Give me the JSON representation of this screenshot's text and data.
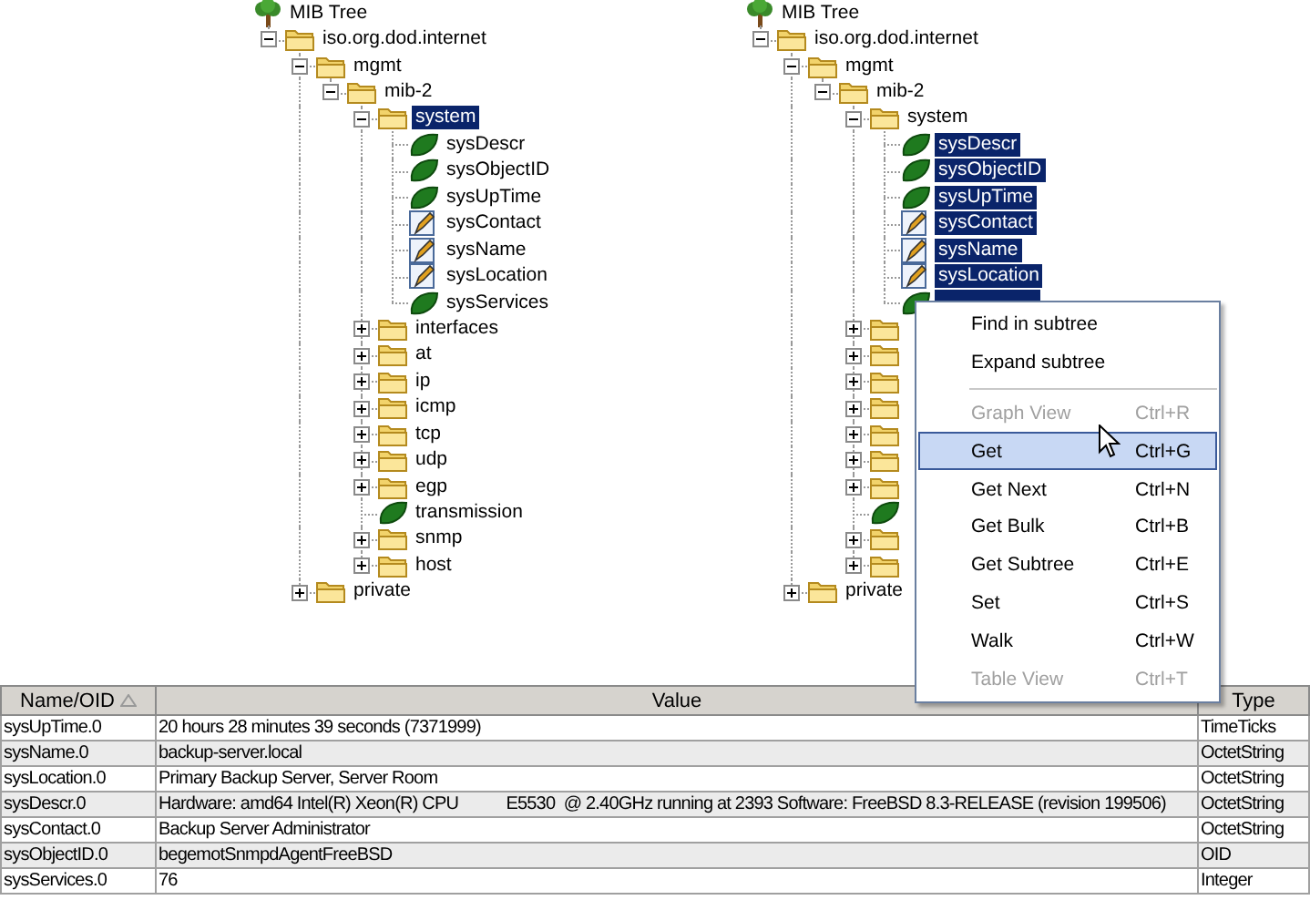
{
  "trees": [
    {
      "title": "MIB Tree",
      "nodes": [
        {
          "kind": "folder",
          "label": "iso.org.dod.internet",
          "expanded": true,
          "selected": false,
          "children": [
            {
              "kind": "folder",
              "label": "mgmt",
              "expanded": true,
              "selected": false,
              "children": [
                {
                  "kind": "folder",
                  "label": "mib-2",
                  "expanded": true,
                  "selected": false,
                  "children": [
                    {
                      "kind": "folder",
                      "label": "system",
                      "expanded": true,
                      "selected": true,
                      "children": [
                        {
                          "kind": "leaf",
                          "label": "sysDescr",
                          "selected": false
                        },
                        {
                          "kind": "leaf",
                          "label": "sysObjectID",
                          "selected": false
                        },
                        {
                          "kind": "leaf",
                          "label": "sysUpTime",
                          "selected": false
                        },
                        {
                          "kind": "writable",
                          "label": "sysContact",
                          "selected": false
                        },
                        {
                          "kind": "writable",
                          "label": "sysName",
                          "selected": false
                        },
                        {
                          "kind": "writable",
                          "label": "sysLocation",
                          "selected": false
                        },
                        {
                          "kind": "leaf",
                          "label": "sysServices",
                          "selected": false
                        }
                      ]
                    },
                    {
                      "kind": "folder",
                      "label": "interfaces",
                      "expanded": false,
                      "selected": false
                    },
                    {
                      "kind": "folder",
                      "label": "at",
                      "expanded": false,
                      "selected": false
                    },
                    {
                      "kind": "folder",
                      "label": "ip",
                      "expanded": false,
                      "selected": false
                    },
                    {
                      "kind": "folder",
                      "label": "icmp",
                      "expanded": false,
                      "selected": false
                    },
                    {
                      "kind": "folder",
                      "label": "tcp",
                      "expanded": false,
                      "selected": false
                    },
                    {
                      "kind": "folder",
                      "label": "udp",
                      "expanded": false,
                      "selected": false
                    },
                    {
                      "kind": "folder",
                      "label": "egp",
                      "expanded": false,
                      "selected": false
                    },
                    {
                      "kind": "leaf",
                      "label": "transmission",
                      "selected": false
                    },
                    {
                      "kind": "folder",
                      "label": "snmp",
                      "expanded": false,
                      "selected": false
                    },
                    {
                      "kind": "folder",
                      "label": "host",
                      "expanded": false,
                      "selected": false
                    }
                  ]
                }
              ]
            },
            {
              "kind": "folder",
              "label": "private",
              "expanded": false,
              "selected": false
            }
          ]
        }
      ]
    },
    {
      "title": "MIB Tree",
      "nodes": [
        {
          "kind": "folder",
          "label": "iso.org.dod.internet",
          "expanded": true,
          "selected": false,
          "children": [
            {
              "kind": "folder",
              "label": "mgmt",
              "expanded": true,
              "selected": false,
              "children": [
                {
                  "kind": "folder",
                  "label": "mib-2",
                  "expanded": true,
                  "selected": false,
                  "children": [
                    {
                      "kind": "folder",
                      "label": "system",
                      "expanded": true,
                      "selected": false,
                      "children": [
                        {
                          "kind": "leaf",
                          "label": "sysDescr",
                          "selected": true
                        },
                        {
                          "kind": "leaf",
                          "label": "sysObjectID",
                          "selected": true
                        },
                        {
                          "kind": "leaf",
                          "label": "sysUpTime",
                          "selected": true
                        },
                        {
                          "kind": "writable",
                          "label": "sysContact",
                          "selected": true
                        },
                        {
                          "kind": "writable",
                          "label": "sysName",
                          "selected": true
                        },
                        {
                          "kind": "writable",
                          "label": "sysLocation",
                          "selected": true
                        },
                        {
                          "kind": "leaf",
                          "selected": true
                        }
                      ]
                    },
                    {
                      "kind": "folder",
                      "expanded": false,
                      "selected": false
                    },
                    {
                      "kind": "folder",
                      "expanded": false,
                      "selected": false
                    },
                    {
                      "kind": "folder",
                      "expanded": false,
                      "selected": false
                    },
                    {
                      "kind": "folder",
                      "expanded": false,
                      "selected": false
                    },
                    {
                      "kind": "folder",
                      "expanded": false,
                      "selected": false
                    },
                    {
                      "kind": "folder",
                      "expanded": false,
                      "selected": false
                    },
                    {
                      "kind": "folder",
                      "expanded": false,
                      "selected": false
                    },
                    {
                      "kind": "leaf",
                      "selected": false
                    },
                    {
                      "kind": "folder",
                      "expanded": false,
                      "selected": false
                    },
                    {
                      "kind": "folder",
                      "expanded": false,
                      "selected": false
                    }
                  ]
                }
              ]
            },
            {
              "kind": "folder",
              "label": "private",
              "expanded": false,
              "selected": false
            }
          ]
        }
      ],
      "context_menu": [
        {
          "kind": "item",
          "label": "Find in subtree",
          "disabled": false,
          "selected": false
        },
        {
          "kind": "item",
          "label": "Expand subtree",
          "disabled": false,
          "selected": false
        },
        {
          "kind": "separator"
        },
        {
          "kind": "item",
          "label": "Graph View",
          "shortcut": "Ctrl+R",
          "disabled": true,
          "selected": false
        },
        {
          "kind": "item",
          "label": "Get",
          "shortcut": "Ctrl+G",
          "disabled": false,
          "selected": true
        },
        {
          "kind": "item",
          "label": "Get Next",
          "shortcut": "Ctrl+N",
          "disabled": false,
          "selected": false
        },
        {
          "kind": "item",
          "label": "Get Bulk",
          "shortcut": "Ctrl+B",
          "disabled": false,
          "selected": false
        },
        {
          "kind": "item",
          "label": "Get Subtree",
          "shortcut": "Ctrl+E",
          "disabled": false,
          "selected": false
        },
        {
          "kind": "item",
          "label": "Set",
          "shortcut": "Ctrl+S",
          "disabled": false,
          "selected": false
        },
        {
          "kind": "item",
          "label": "Walk",
          "shortcut": "Ctrl+W",
          "disabled": false,
          "selected": false
        },
        {
          "kind": "item",
          "label": "Table View",
          "shortcut": "Ctrl+T",
          "disabled": true,
          "selected": false
        }
      ]
    }
  ],
  "table": {
    "columns": [
      {
        "label": "Name/OID",
        "sorted": true
      },
      {
        "label": "Value",
        "sorted": false
      },
      {
        "label": "Type",
        "sorted": false
      }
    ],
    "rows": [
      [
        "sysUpTime.0",
        "20 hours 28 minutes 39 seconds (7371999)",
        "TimeTicks"
      ],
      [
        "sysName.0",
        "backup-server.local",
        "OctetString"
      ],
      [
        "sysLocation.0",
        "Primary Backup Server, Server Room",
        "OctetString"
      ],
      [
        "sysDescr.0",
        "Hardware: amd64 Intel(R) Xeon(R) CPU           E5530  @ 2.40GHz running at 2393 Software: FreeBSD 8.3-RELEASE (revision 199506)",
        "OctetString"
      ],
      [
        "sysContact.0",
        "Backup Server Administrator",
        "OctetString"
      ],
      [
        "sysObjectID.0",
        "begemotSnmpdAgentFreeBSD",
        "OID"
      ],
      [
        "sysServices.0",
        "76",
        "Integer"
      ]
    ]
  }
}
